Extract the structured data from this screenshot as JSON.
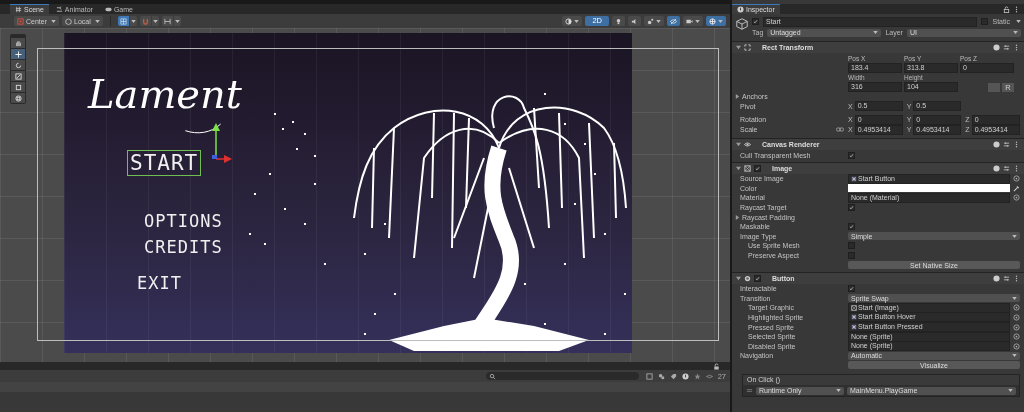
{
  "scene_tabs": [
    {
      "label": "Scene",
      "kind": "scene",
      "selected": true
    },
    {
      "label": "Animator",
      "kind": "animator",
      "selected": false
    },
    {
      "label": "Game",
      "kind": "game",
      "selected": false
    }
  ],
  "scene_toolbar": {
    "pivot_mode": "Center",
    "pivot_rotation": "Local",
    "snap_options": [
      {
        "kind": "grid",
        "selected": true
      },
      {
        "kind": "snap",
        "selected": false
      },
      {
        "kind": "increment",
        "selected": false
      }
    ],
    "view_options": [
      {
        "kind": "shading",
        "selected": false
      },
      {
        "kind": "dimension",
        "label": "2D",
        "selected": true
      },
      {
        "kind": "lighting",
        "selected": false
      },
      {
        "kind": "audio",
        "selected": false
      },
      {
        "kind": "effects",
        "selected": false
      },
      {
        "kind": "visibility",
        "selected": true
      },
      {
        "kind": "camera",
        "selected": false
      },
      {
        "kind": "gizmos",
        "selected": true
      }
    ]
  },
  "tools": [
    {
      "kind": "hand",
      "selected": false
    },
    {
      "kind": "move",
      "selected": true
    },
    {
      "kind": "rotate",
      "selected": false
    },
    {
      "kind": "scale",
      "selected": false
    },
    {
      "kind": "rect",
      "selected": false
    },
    {
      "kind": "transform",
      "selected": false
    }
  ],
  "game_ui": {
    "title": "Lament",
    "buttons": [
      {
        "label": "START",
        "selected": true
      },
      {
        "label": "OPTIONS",
        "selected": false
      },
      {
        "label": "CREDITS",
        "selected": false
      },
      {
        "label": "EXIT",
        "selected": false
      }
    ]
  },
  "bottom_panel": {
    "hidden_count": "27"
  },
  "inspector": {
    "title": "Inspector",
    "object": {
      "name": "Start",
      "active": true,
      "static_label": "Static",
      "static": false,
      "tag_label": "Tag",
      "tag": "Untagged",
      "layer_label": "Layer",
      "layer": "UI"
    },
    "rect_transform": {
      "title": "Rect Transform",
      "expanded": true,
      "position": [
        {
          "label": "Pos X",
          "value": "183.4"
        },
        {
          "label": "Pos Y",
          "value": "313.8"
        },
        {
          "label": "Pos Z",
          "value": "0"
        }
      ],
      "size": [
        {
          "label": "Width",
          "value": "316"
        },
        {
          "label": "Height",
          "value": "104"
        }
      ],
      "raw_button": "R",
      "anchors": {
        "label": "Anchors",
        "expanded": false
      },
      "pivot": {
        "label": "Pivot",
        "axes": [
          {
            "axis": "X",
            "value": "0.5"
          },
          {
            "axis": "Y",
            "value": "0.5"
          }
        ]
      },
      "rotation": {
        "label": "Rotation",
        "axes": [
          {
            "axis": "X",
            "value": "0"
          },
          {
            "axis": "Y",
            "value": "0"
          },
          {
            "axis": "Z",
            "value": "0"
          }
        ]
      },
      "scale": {
        "label": "Scale",
        "axes": [
          {
            "axis": "X",
            "value": "0.4953414"
          },
          {
            "axis": "Y",
            "value": "0.4953414"
          },
          {
            "axis": "Z",
            "value": "0.4953414"
          }
        ]
      }
    },
    "components": [
      {
        "kind": "canvas_renderer",
        "title": "Canvas Renderer",
        "expanded": true,
        "rows": [
          {
            "kind": "checkbox",
            "label": "Cull Transparent Mesh",
            "checked": true
          }
        ]
      },
      {
        "kind": "image",
        "title": "Image",
        "enabled": true,
        "expanded": true,
        "rows": [
          {
            "kind": "sprite",
            "label": "Source Image",
            "value": "Start Button"
          },
          {
            "kind": "color",
            "label": "Color",
            "color": "#ffffff"
          },
          {
            "kind": "object",
            "label": "Material",
            "value": "None (Material)"
          },
          {
            "kind": "checkbox",
            "label": "Raycast Target",
            "checked": true
          },
          {
            "kind": "foldout",
            "label": "Raycast Padding",
            "expanded": false
          },
          {
            "kind": "checkbox",
            "label": "Maskable",
            "checked": true
          },
          {
            "kind": "dropdown",
            "label": "Image Type",
            "value": "Simple",
            "children": [
              {
                "kind": "checkbox",
                "label": "Use Sprite Mesh",
                "checked": false
              },
              {
                "kind": "checkbox",
                "label": "Preserve Aspect",
                "checked": false
              }
            ]
          },
          {
            "kind": "button",
            "label": "Set Native Size"
          }
        ]
      },
      {
        "kind": "button",
        "title": "Button",
        "enabled": true,
        "expanded": true,
        "rows": [
          {
            "kind": "checkbox",
            "label": "Interactable",
            "checked": true
          },
          {
            "kind": "dropdown",
            "label": "Transition",
            "value": "Sprite Swap",
            "children": [
              {
                "kind": "graphic",
                "label": "Target Graphic",
                "value": "Start (Image)"
              },
              {
                "kind": "sprite",
                "label": "Highlighted Sprite",
                "value": "Start Button Hover"
              },
              {
                "kind": "sprite",
                "label": "Pressed Sprite",
                "value": "Start Button Pressed"
              },
              {
                "kind": "object",
                "label": "Selected Sprite",
                "value": "None (Sprite)"
              },
              {
                "kind": "object",
                "label": "Disabled Sprite",
                "value": "None (Sprite)"
              }
            ]
          },
          {
            "kind": "dropdown",
            "label": "Navigation",
            "value": "Automatic"
          },
          {
            "kind": "button",
            "label": "Visualize"
          }
        ],
        "event": {
          "title": "On Click ()",
          "entries": [
            {
              "mode": "Runtime Only",
              "function": "MainMenu.PlayGame"
            }
          ]
        }
      }
    ]
  }
}
